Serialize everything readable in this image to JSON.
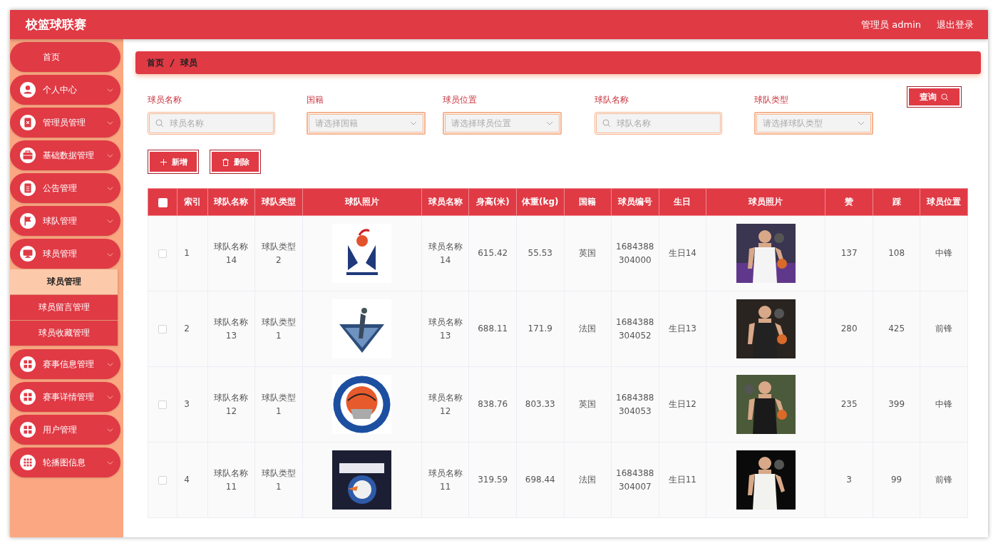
{
  "header": {
    "title": "校篮球联赛",
    "user": "管理员 admin",
    "logout": "退出登录"
  },
  "sidebar": {
    "items": [
      {
        "label": "首页"
      },
      {
        "label": "个人中心",
        "expanded": false
      },
      {
        "label": "管理员管理",
        "expanded": false
      },
      {
        "label": "基础数据管理",
        "expanded": false
      },
      {
        "label": "公告管理",
        "expanded": false
      },
      {
        "label": "球队管理",
        "expanded": false
      },
      {
        "label": "球员管理",
        "expanded": true,
        "children": [
          {
            "label": "球员管理",
            "selected": true
          },
          {
            "label": "球员留言管理",
            "selected": false
          },
          {
            "label": "球员收藏管理",
            "selected": false
          }
        ]
      },
      {
        "label": "赛事信息管理",
        "expanded": false
      },
      {
        "label": "赛事详情管理",
        "expanded": false
      },
      {
        "label": "用户管理",
        "expanded": false
      },
      {
        "label": "轮播图信息",
        "expanded": false
      }
    ]
  },
  "breadcrumb": [
    "首页",
    "球员"
  ],
  "filters": [
    {
      "label": "球员名称",
      "kind": "text",
      "placeholder": "球员名称"
    },
    {
      "label": "国籍",
      "kind": "select",
      "placeholder": "请选择国籍"
    },
    {
      "label": "球员位置",
      "kind": "select",
      "placeholder": "请选择球员位置"
    },
    {
      "label": "球队名称",
      "kind": "text",
      "placeholder": "球队名称"
    },
    {
      "label": "球队类型",
      "kind": "select",
      "placeholder": "请选择球队类型"
    }
  ],
  "search_button": "查询",
  "actions": [
    {
      "label": "新增",
      "kind": "add"
    },
    {
      "label": "删除",
      "kind": "delete"
    }
  ],
  "table": {
    "all_checked": false,
    "columns": [
      {
        "label": "索引",
        "kind": "text"
      },
      {
        "label": "球队名称",
        "kind": "text"
      },
      {
        "label": "球队类型",
        "kind": "text"
      },
      {
        "label": "球队照片",
        "kind": "logo"
      },
      {
        "label": "球员名称",
        "kind": "text"
      },
      {
        "label": "身高(米)",
        "kind": "text"
      },
      {
        "label": "体重(kg)",
        "kind": "text"
      },
      {
        "label": "国籍",
        "kind": "text"
      },
      {
        "label": "球员编号",
        "kind": "text"
      },
      {
        "label": "生日",
        "kind": "text"
      },
      {
        "label": "球员照片"
      },
      {
        "label": "赞",
        "kind": "text"
      },
      {
        "label": "踩",
        "kind": "text"
      },
      {
        "label": "球员位置",
        "kind": "text"
      }
    ],
    "rows": [
      {
        "checked": false,
        "cells": [
          "1",
          "球队名称14",
          "球队类型2",
          {
            "kind": "picture"
          },
          "球员名称14",
          "615.42",
          "55.53",
          "英国",
          "1684388304000",
          "生日14",
          {
            "kind": "picture"
          },
          "137",
          "108",
          "中锋"
        ]
      },
      {
        "checked": false,
        "cells": [
          "2",
          "球队名称13",
          "球队类型1",
          {
            "kind": "picture"
          },
          "球员名称13",
          "688.11",
          "171.9",
          "法国",
          "1684388304052",
          "生日13",
          {
            "kind": "picture"
          },
          "280",
          "425",
          "前锋"
        ]
      },
      {
        "checked": false,
        "cells": [
          "3",
          "球队名称12",
          "球队类型1",
          {
            "kind": "picture"
          },
          "球员名称12",
          "838.76",
          "803.33",
          "英国",
          "1684388304053",
          "生日12",
          {
            "kind": "picture"
          },
          "235",
          "399",
          "中锋"
        ]
      },
      {
        "checked": false,
        "cells": [
          "4",
          "球队名称11",
          "球队类型1",
          {
            "kind": "picture"
          },
          "球员名称11",
          "319.59",
          "698.44",
          "法国",
          "1684388304007",
          "生日11",
          {
            "kind": "picture"
          },
          "3",
          "99",
          "前锋"
        ]
      }
    ]
  }
}
